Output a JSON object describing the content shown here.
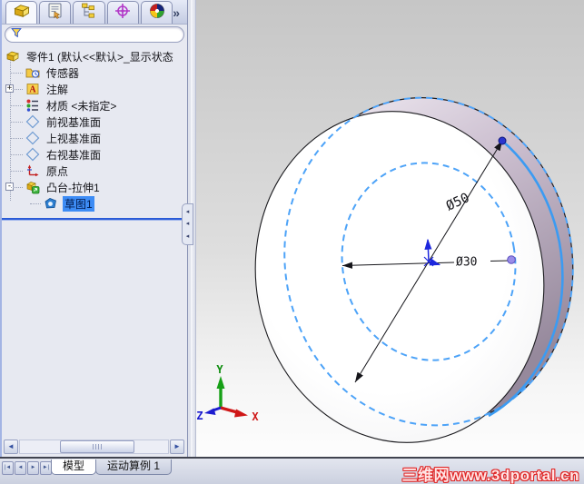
{
  "panel": {
    "chevron": "»",
    "tabs": [
      {
        "icon": "featuremanager-part-icon"
      },
      {
        "icon": "propertymanager-icon"
      },
      {
        "icon": "configurationmanager-icon"
      },
      {
        "icon": "dimxpertmanager-icon"
      },
      {
        "icon": "displaymanager-icon"
      }
    ],
    "filter": {
      "value": ""
    },
    "tree": {
      "root": "零件1  (默认<<默认>_显示状态",
      "items": [
        {
          "label": "传感器"
        },
        {
          "label": "注解",
          "expander": "+"
        },
        {
          "label": "材质 <未指定>"
        },
        {
          "label": "前视基准面"
        },
        {
          "label": "上视基准面"
        },
        {
          "label": "右视基准面"
        },
        {
          "label": "原点"
        },
        {
          "label": "凸台-拉伸1",
          "expander": "-"
        },
        {
          "label": "草图1",
          "selected": true
        }
      ]
    },
    "scrollbar": {
      "left": "◄",
      "right": "►"
    },
    "collapse_arrow": "◂"
  },
  "viewport": {
    "dimensions": {
      "d50": "Ø50",
      "d30": "Ø30"
    },
    "triad": {
      "x": "X",
      "y": "Y",
      "z": "Z"
    }
  },
  "bottom": {
    "nav": [
      "|◄",
      "◄",
      "►",
      "►|"
    ],
    "tabs": [
      {
        "label": "模型",
        "active": true
      },
      {
        "label": "运动算例 1",
        "active": false
      }
    ]
  },
  "watermark": "三维网www.3dportal.cn",
  "colors": {
    "sketch_blue": "#4da3f8",
    "selection_blue": "#3d8cf5",
    "rollback_blue": "#2a5bd7",
    "side_face_mauve": "#a396a8",
    "watermark_red": "#e02525"
  }
}
